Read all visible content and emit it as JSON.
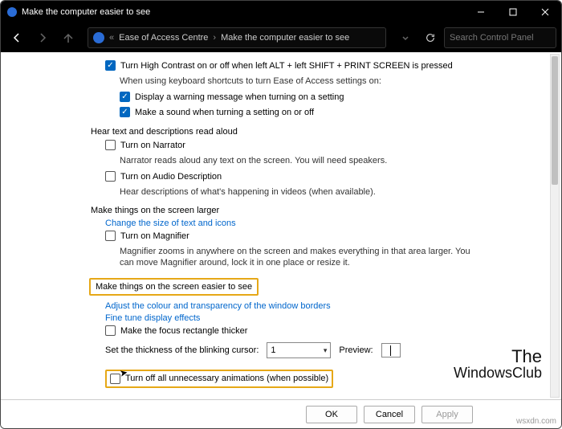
{
  "titlebar": {
    "title": "Make the computer easier to see"
  },
  "breadcrumb": {
    "a": "Ease of Access Centre",
    "b": "Make the computer easier to see"
  },
  "search": {
    "placeholder": "Search Control Panel"
  },
  "items": {
    "highContrast": "Turn High Contrast on or off when left ALT + left SHIFT + PRINT SCREEN is pressed",
    "kbIntro": "When using keyboard shortcuts to turn Ease of Access settings on:",
    "warn": "Display a warning message when turning on a setting",
    "sound": "Make a sound when turning a setting on or off",
    "hearHeader": "Hear text and descriptions read aloud",
    "narrator": "Turn on Narrator",
    "narratorDesc": "Narrator reads aloud any text on the screen. You will need speakers.",
    "audioDesc": "Turn on Audio Description",
    "audioDescDesc": "Hear descriptions of what's happening in videos (when available).",
    "largerHeader": "Make things on the screen larger",
    "changeSize": "Change the size of text and icons",
    "magnifier": "Turn on Magnifier",
    "magnifierDesc": "Magnifier zooms in anywhere on the screen and makes everything in that area larger. You can move Magnifier around, lock it in one place or resize it.",
    "easierHeader": "Make things on the screen easier to see",
    "adjustColour": "Adjust the colour and transparency of the window borders",
    "fineTune": "Fine tune display effects",
    "focusRect": "Make the focus rectangle thicker",
    "thicknessLabel": "Set the thickness of the blinking cursor:",
    "thicknessValue": "1",
    "previewLabel": "Preview:",
    "turnOffAnim": "Turn off all unnecessary animations (when possible)"
  },
  "buttons": {
    "ok": "OK",
    "cancel": "Cancel",
    "apply": "Apply"
  },
  "watermark": {
    "l1": "The",
    "l2": "WindowsClub"
  },
  "wsx": "wsxdn.com"
}
